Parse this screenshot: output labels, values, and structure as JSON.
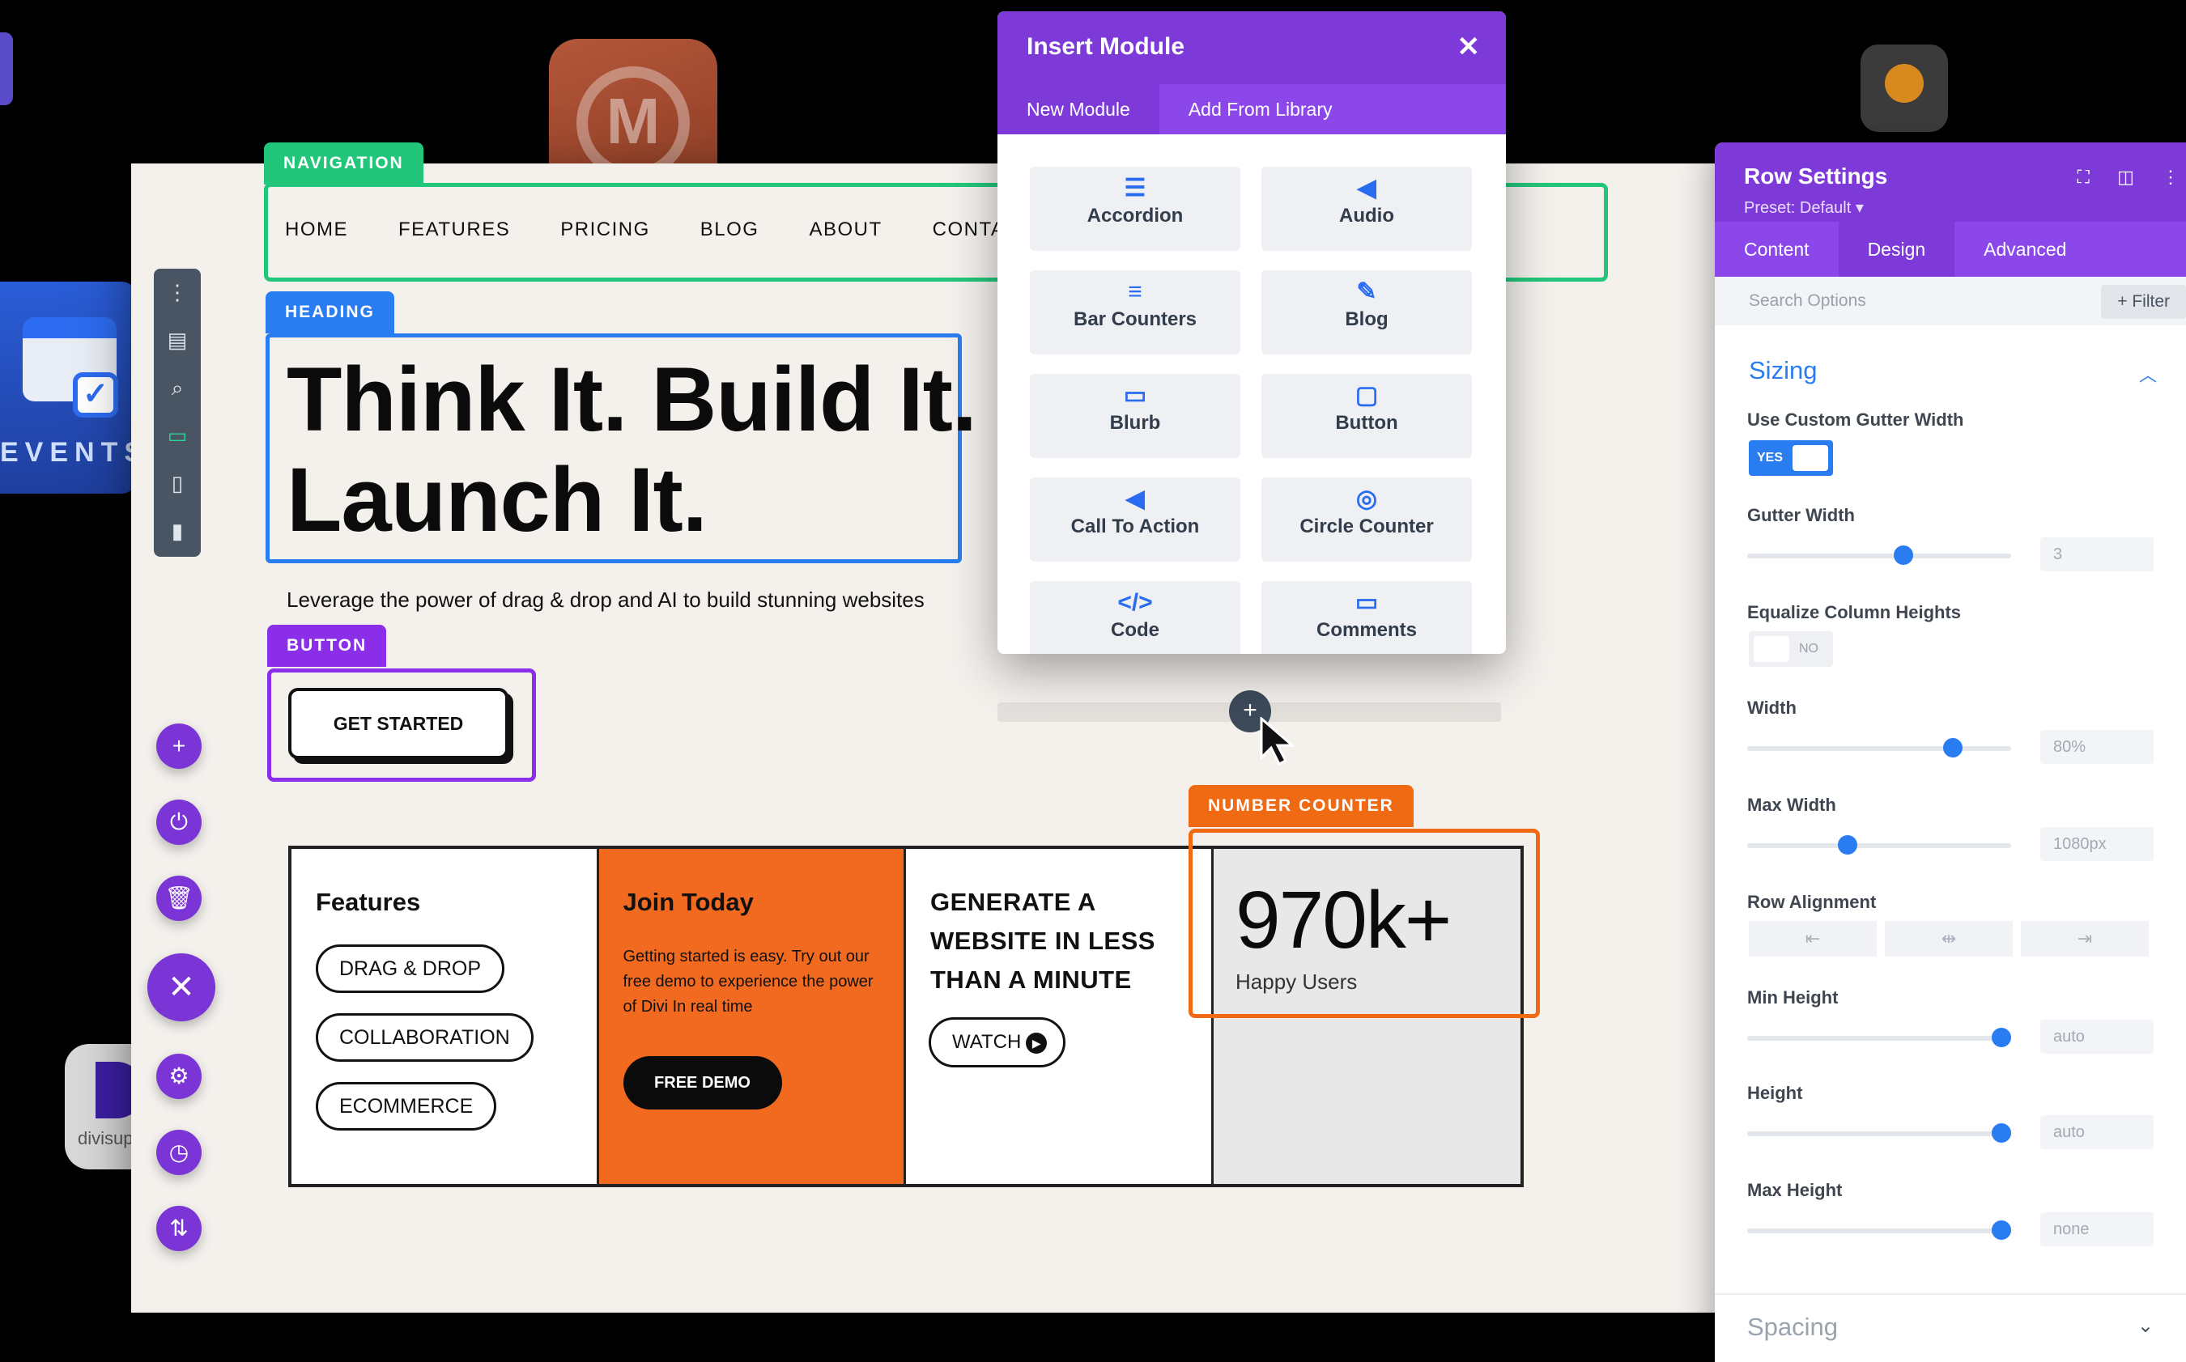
{
  "apps": {
    "events_label": "EVENTS",
    "divi_label": "divisup",
    "m_letter": "M"
  },
  "tags": {
    "navigation": "NAVIGATION",
    "heading": "HEADING",
    "button": "BUTTON",
    "number_counter": "NUMBER COUNTER"
  },
  "nav": {
    "items": [
      "HOME",
      "FEATURES",
      "PRICING",
      "BLOG",
      "ABOUT",
      "CONTACT"
    ]
  },
  "hero": {
    "headline_1": "Think It. Build It.",
    "headline_2": "Launch It.",
    "subline": "Leverage the power of drag & drop and AI to build stunning websites",
    "cta": "GET STARTED"
  },
  "grid": {
    "features_title": "Features",
    "features_pills": [
      "DRAG & DROP",
      "COLLABORATION",
      "ECOMMERCE"
    ],
    "join_title": "Join Today",
    "join_text": "Getting started is easy. Try out our free demo to experience the power of Divi In real time",
    "join_button": "FREE DEMO",
    "generate_title": "GENERATE A WEBSITE IN LESS THAN A MINUTE",
    "watch_button": "WATCH"
  },
  "counter": {
    "value": "970k+",
    "label": "Happy Users"
  },
  "modal": {
    "title": "Insert Module",
    "tabs": [
      "New Module",
      "Add From Library"
    ],
    "modules": [
      {
        "icon": "accordion-icon",
        "glyph": "☰",
        "label": "Accordion"
      },
      {
        "icon": "audio-icon",
        "glyph": "◀",
        "label": "Audio"
      },
      {
        "icon": "bar-counters-icon",
        "glyph": "≡",
        "label": "Bar Counters"
      },
      {
        "icon": "blog-icon",
        "glyph": "✎",
        "label": "Blog"
      },
      {
        "icon": "blurb-icon",
        "glyph": "▭",
        "label": "Blurb"
      },
      {
        "icon": "button-icon",
        "glyph": "▢",
        "label": "Button"
      },
      {
        "icon": "call-to-action-icon",
        "glyph": "◀",
        "label": "Call To Action"
      },
      {
        "icon": "circle-counter-icon",
        "glyph": "◎",
        "label": "Circle Counter"
      },
      {
        "icon": "code-icon",
        "glyph": "</>",
        "label": "Code"
      },
      {
        "icon": "comments-icon",
        "glyph": "▭",
        "label": "Comments"
      }
    ]
  },
  "panel": {
    "title": "Row Settings",
    "preset": "Preset: Default ▾",
    "tabs": [
      "Content",
      "Design",
      "Advanced"
    ],
    "search_placeholder": "Search Options",
    "filter": "+ Filter",
    "section": "Sizing",
    "options": {
      "custom_gutter": "Use Custom Gutter Width",
      "custom_gutter_state": "YES",
      "gutter_width": "Gutter Width",
      "gutter_value": "3",
      "gutter_fraction": 0.6,
      "equalize": "Equalize Column Heights",
      "equalize_state": "NO",
      "width": "Width",
      "width_value": "80%",
      "width_fraction": 0.8,
      "max_width": "Max Width",
      "max_width_value": "1080px",
      "max_width_fraction": 0.37,
      "row_alignment": "Row Alignment",
      "min_height": "Min Height",
      "min_height_value": "auto",
      "height": "Height",
      "height_value": "auto",
      "max_height": "Max Height",
      "max_height_value": "none"
    },
    "spacing": "Spacing"
  },
  "colors": {
    "accent_purple": "#7d3ad9",
    "nav_green": "#22c67a",
    "heading_blue": "#2a7df0",
    "button_purple": "#8a2ee8",
    "counter_orange": "#f06a14"
  }
}
